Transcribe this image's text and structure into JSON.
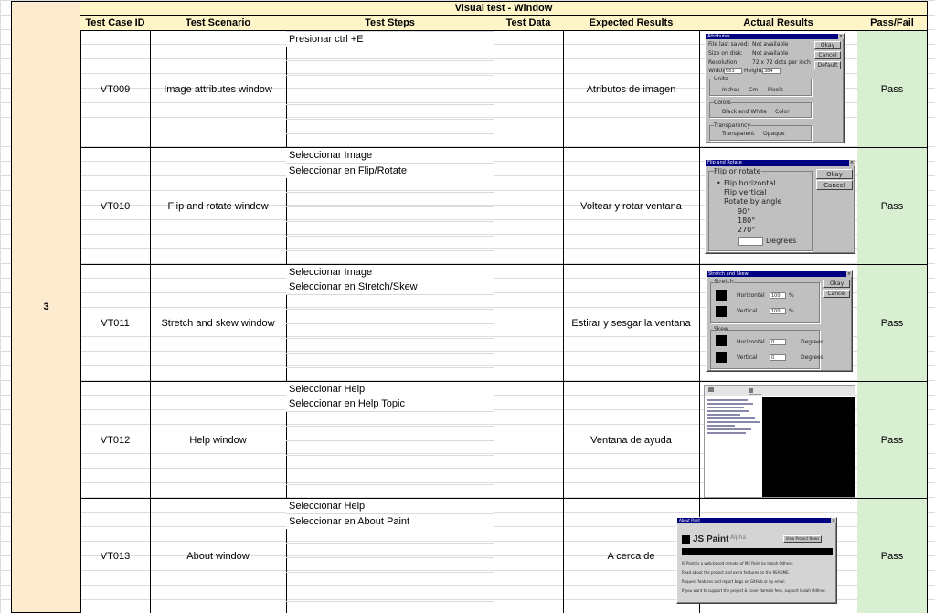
{
  "section_title": "Visual test - Window",
  "group_id": "3",
  "headers": {
    "id": "Test Case ID",
    "scenario": "Test Scenario",
    "steps": "Test Steps",
    "data": "Test Data",
    "expected": "Expected Results",
    "actual": "Actual Results",
    "pass": "Pass/Fail"
  },
  "rows": [
    {
      "id": "VT009",
      "scenario": "Image attributes window",
      "steps": [
        "Presionar ctrl +E"
      ],
      "data": "",
      "expected": "Atributos de imagen",
      "result": "Pass"
    },
    {
      "id": "VT010",
      "scenario": "Flip and rotate window",
      "steps": [
        "Seleccionar Image",
        "Seleccionar en Flip/Rotate"
      ],
      "data": "",
      "expected": "Voltear y rotar ventana",
      "result": "Pass"
    },
    {
      "id": "VT011",
      "scenario": "Stretch and skew window",
      "steps": [
        "Seleccionar Image",
        "Seleccionar en Stretch/Skew"
      ],
      "data": "",
      "expected": "Estirar y sesgar la ventana",
      "result": "Pass"
    },
    {
      "id": "VT012",
      "scenario": "Help window",
      "steps": [
        "Seleccionar Help",
        "Seleccionar en Help Topic"
      ],
      "data": "",
      "expected": "Ventana de ayuda",
      "result": "Pass"
    },
    {
      "id": "VT013",
      "scenario": "About window",
      "steps": [
        "Seleccionar Help",
        "Seleccionar en About Paint"
      ],
      "data": "",
      "expected": "A cerca de",
      "result": "Pass"
    }
  ],
  "attributes_dialog": {
    "title": "Attributes",
    "file_saved": "File last saved:",
    "file_saved_val": "Not available",
    "size": "Size on disk:",
    "size_val": "Not available",
    "res": "Resolution:",
    "res_val": "72 x 72 dots per inch",
    "width": "Width",
    "width_val": "683",
    "height": "Height",
    "height_val": "384",
    "units": "Units",
    "inches": "Inches",
    "cm": "Cm",
    "pixels": "Pixels",
    "colors": "Colors",
    "bw": "Black and White",
    "color": "Color",
    "transparency": "Transparency",
    "transparent": "Transparent",
    "opaque": "Opaque",
    "okay": "Okay",
    "cancel": "Cancel",
    "default": "Default"
  },
  "flip_dialog": {
    "title": "Flip and Rotate",
    "group": "Flip or rotate",
    "fh": "Flip horizontal",
    "fv": "Flip vertical",
    "rba": "Rotate by angle",
    "a90": "90°",
    "a180": "180°",
    "a270": "270°",
    "degrees": "Degrees",
    "okay": "Okay",
    "cancel": "Cancel"
  },
  "stretch_dialog": {
    "title": "Stretch and Skew",
    "stretch": "Stretch",
    "skew": "Skew",
    "horizontal": "Horizontal",
    "vertical": "Vertical",
    "pct": "%",
    "degrees": "Degrees",
    "h_val": "100",
    "v_val": "100",
    "sh_val": "0",
    "sv_val": "0",
    "okay": "Okay",
    "cancel": "Cancel"
  },
  "about_dialog": {
    "title": "About Paint",
    "app": "JS Paint",
    "alpha": "Alpha",
    "view_notes": "View Project News",
    "line1": "JS Paint is a web-based remake of MS Paint by Isaiah Odhner.",
    "line2": "Read about the project and extra features on the README.",
    "line3": "Request features and report bugs on GitHub or by email.",
    "line4": "If you want to support the project & cover domain fees, support Isaiah Odhner."
  },
  "colors": {
    "peach": "#fdebd0",
    "header": "#fef5c9",
    "pass": "#d8efd2",
    "win_bg": "#c0c0c0",
    "title_bar": "#000080"
  }
}
